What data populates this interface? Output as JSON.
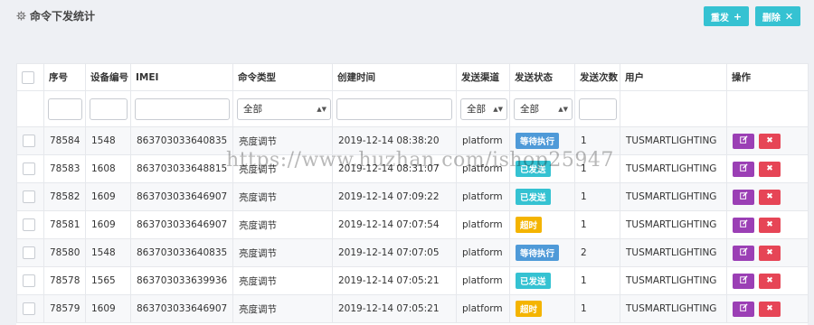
{
  "header": {
    "title": "命令下发统计",
    "resend_label": "重发",
    "delete_label": "删除"
  },
  "table": {
    "columns": [
      "序号",
      "设备编号",
      "IMEI",
      "命令类型",
      "创建时间",
      "发送渠道",
      "发送状态",
      "发送次数",
      "用户",
      "操作"
    ],
    "filters": {
      "command_type": "全部",
      "channel": "全部",
      "status": "全部"
    },
    "rows": [
      {
        "id": "78584",
        "device": "1548",
        "imei": "863703033640835",
        "type": "亮度调节",
        "created": "2019-12-14 08:38:20",
        "channel": "platform",
        "status": "等待执行",
        "status_kind": "waiting",
        "count": "1",
        "user": "TUSMARTLIGHTING"
      },
      {
        "id": "78583",
        "device": "1608",
        "imei": "863703033648815",
        "type": "亮度调节",
        "created": "2019-12-14 08:31:07",
        "channel": "platform",
        "status": "已发送",
        "status_kind": "sent",
        "count": "1",
        "user": "TUSMARTLIGHTING"
      },
      {
        "id": "78582",
        "device": "1609",
        "imei": "863703033646907",
        "type": "亮度调节",
        "created": "2019-12-14 07:09:22",
        "channel": "platform",
        "status": "已发送",
        "status_kind": "sent",
        "count": "1",
        "user": "TUSMARTLIGHTING"
      },
      {
        "id": "78581",
        "device": "1609",
        "imei": "863703033646907",
        "type": "亮度调节",
        "created": "2019-12-14 07:07:54",
        "channel": "platform",
        "status": "超时",
        "status_kind": "timeout",
        "count": "1",
        "user": "TUSMARTLIGHTING"
      },
      {
        "id": "78580",
        "device": "1548",
        "imei": "863703033640835",
        "type": "亮度调节",
        "created": "2019-12-14 07:07:05",
        "channel": "platform",
        "status": "等待执行",
        "status_kind": "waiting",
        "count": "2",
        "user": "TUSMARTLIGHTING"
      },
      {
        "id": "78578",
        "device": "1565",
        "imei": "863703033639936",
        "type": "亮度调节",
        "created": "2019-12-14 07:05:21",
        "channel": "platform",
        "status": "已发送",
        "status_kind": "sent",
        "count": "1",
        "user": "TUSMARTLIGHTING"
      },
      {
        "id": "78579",
        "device": "1609",
        "imei": "863703033646907",
        "type": "亮度调节",
        "created": "2019-12-14 07:05:21",
        "channel": "platform",
        "status": "超时",
        "status_kind": "timeout",
        "count": "1",
        "user": "TUSMARTLIGHTING"
      }
    ]
  },
  "watermark": "https://www.huzhan.com/ishop25947",
  "colors": {
    "accent": "#35c2d2",
    "waiting": "#4f9ad8",
    "timeout": "#f4b400",
    "edit": "#9b3fb5",
    "delete": "#e64556"
  },
  "icons": {
    "title": "gear-icon",
    "resend": "plus-icon",
    "delete": "close-icon",
    "row_edit": "edit-icon",
    "row_delete": "close-icon"
  }
}
